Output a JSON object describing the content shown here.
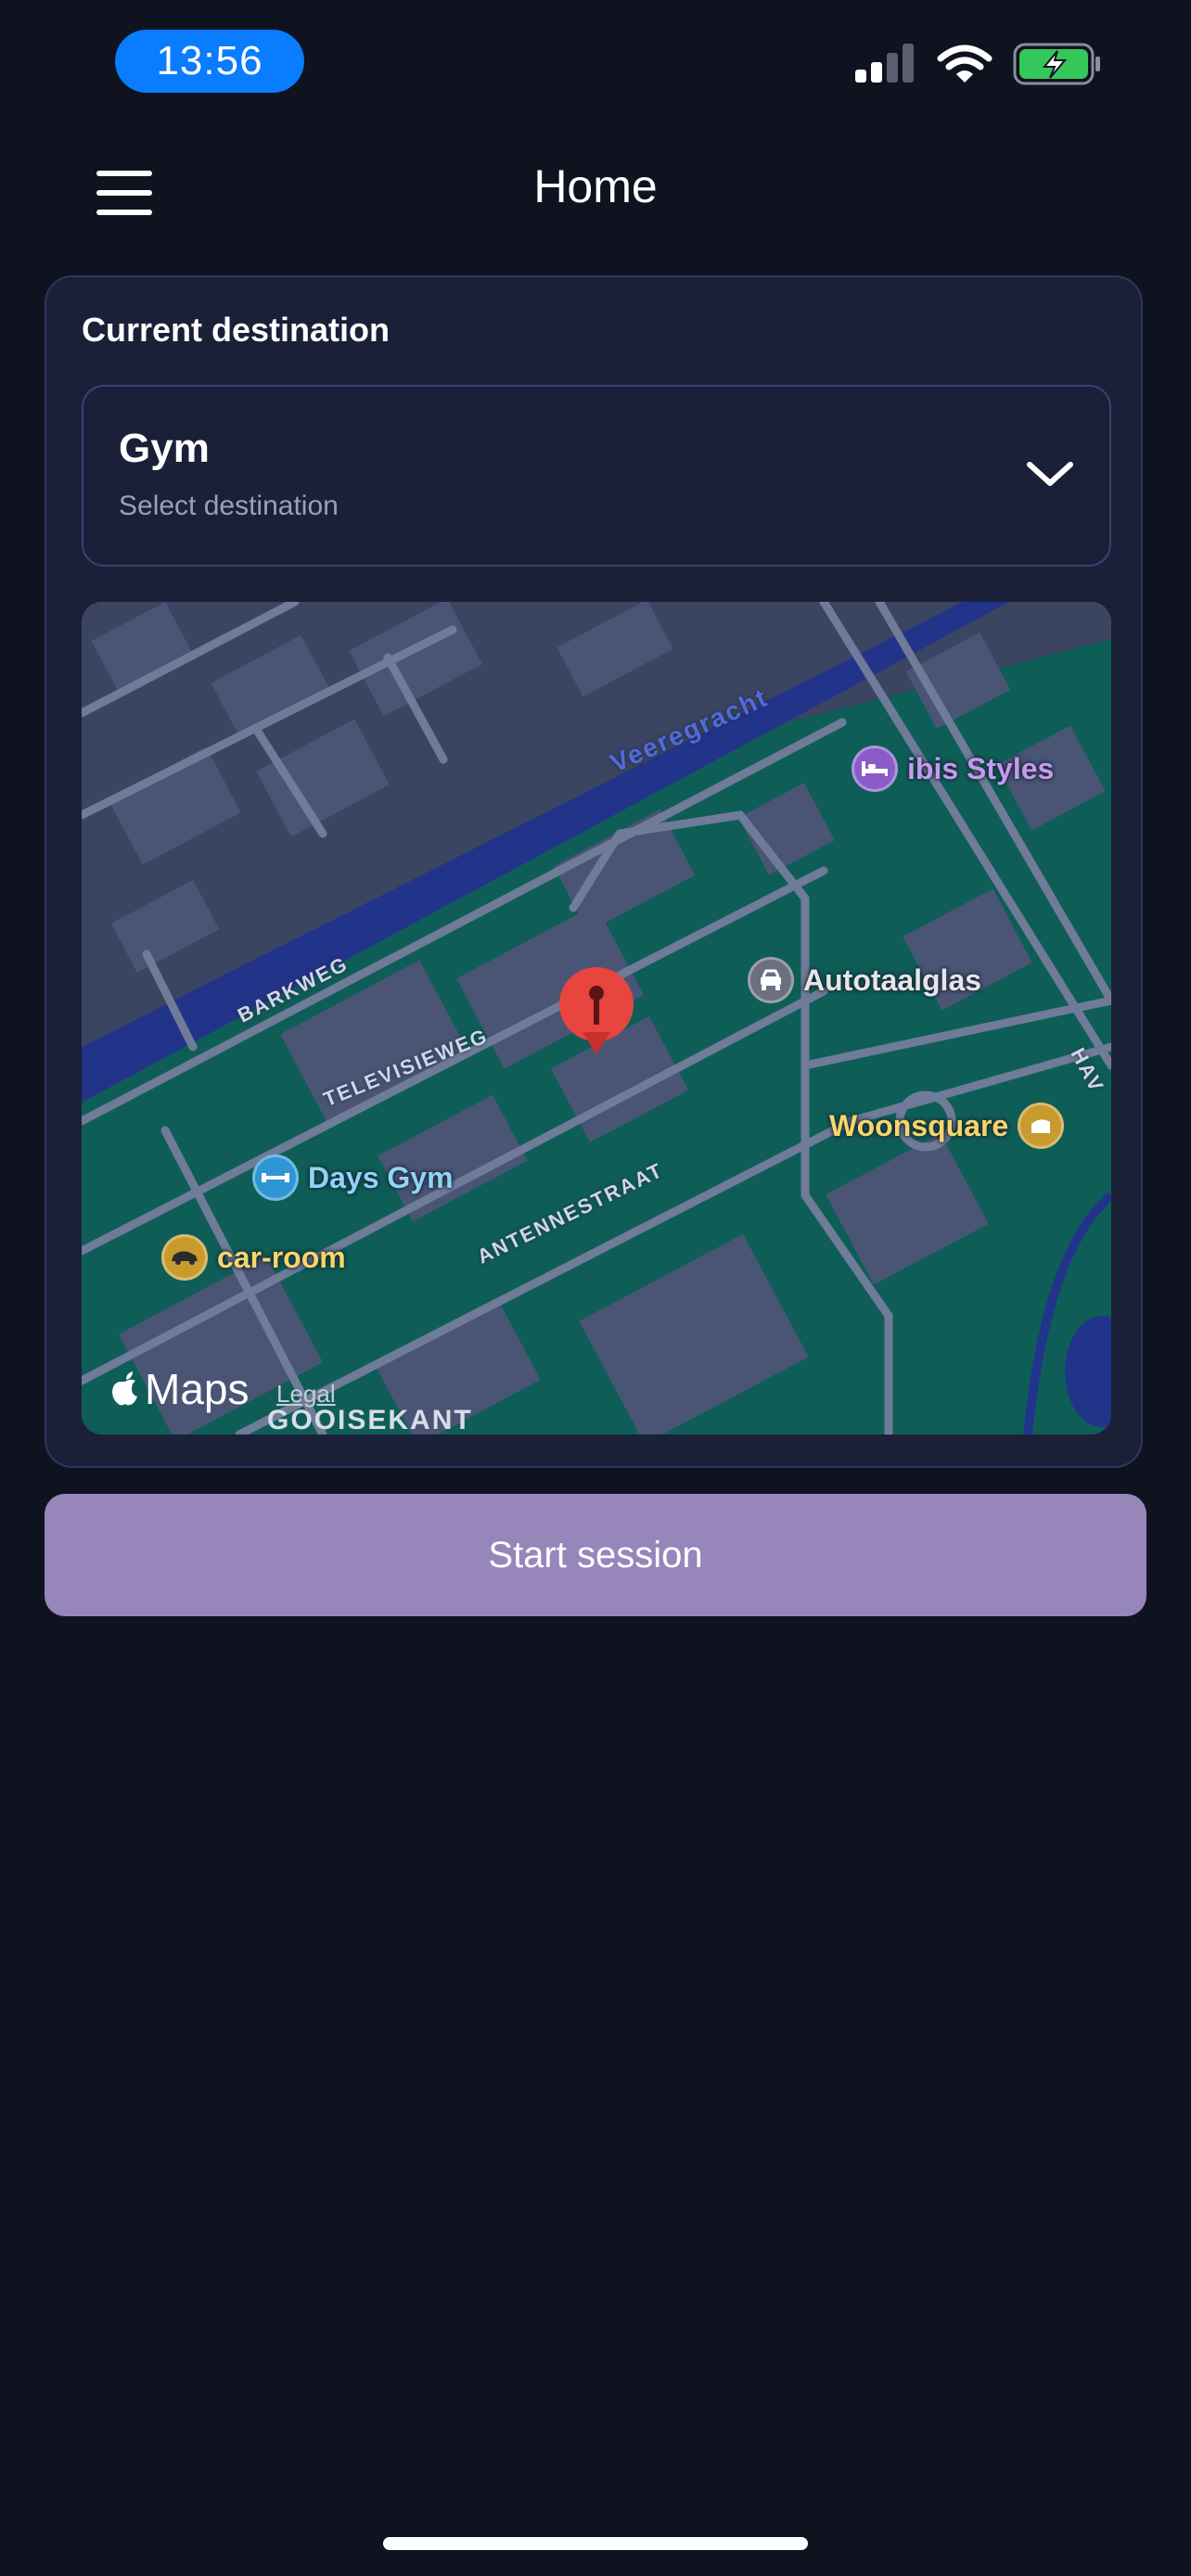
{
  "status_bar": {
    "time": "13:56"
  },
  "header": {
    "title": "Home"
  },
  "card": {
    "label": "Current destination",
    "select": {
      "value": "Gym",
      "placeholder": "Select destination"
    }
  },
  "map": {
    "pois": [
      {
        "name": "ibis Styles",
        "icon": "bed-icon",
        "color": "#c39bf0"
      },
      {
        "name": "Autotaalglas",
        "icon": "car-front-icon",
        "color": "#e6e6e6"
      },
      {
        "name": "Woonsquare",
        "icon": "furniture-icon",
        "color": "#f5d66b"
      },
      {
        "name": "Days Gym",
        "icon": "dumbbell-icon",
        "color": "#8fd4f5"
      },
      {
        "name": "car-room",
        "icon": "car-icon",
        "color": "#f5d66b"
      }
    ],
    "streets": [
      "Veeregracht",
      "BARKWEG",
      "TELEVISIEWEG",
      "ANTENNESTRAAT",
      "HAV",
      "GOOISEKANT"
    ],
    "attribution": {
      "brand": "Maps",
      "legal": "Legal"
    }
  },
  "actions": {
    "start_label": "Start session"
  }
}
